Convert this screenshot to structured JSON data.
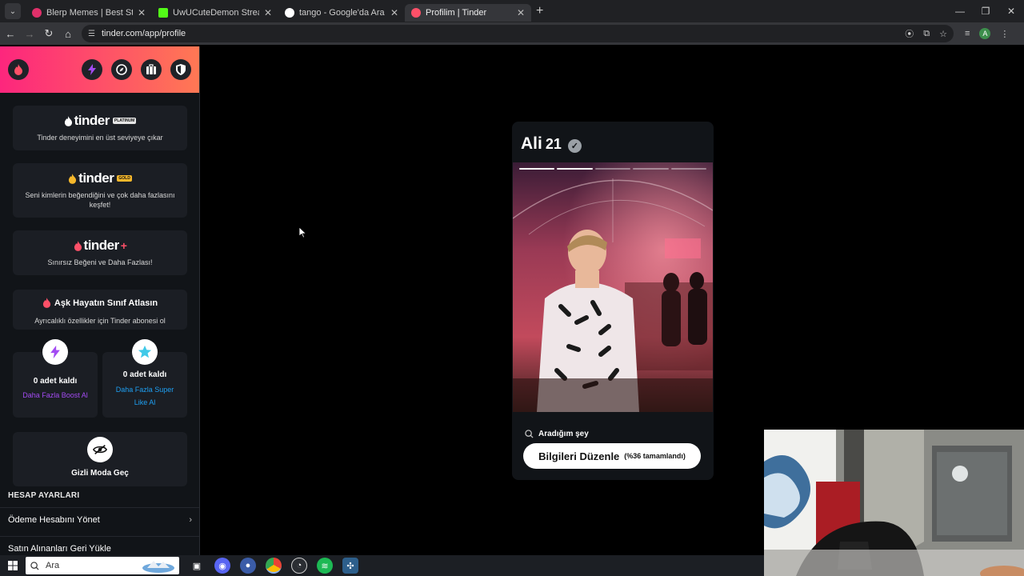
{
  "browser": {
    "tabs": [
      {
        "title": "Blerp Memes | Best Streamer So",
        "favicon_color": "#e0306a"
      },
      {
        "title": "UwUCuteDemon Stream - Watc",
        "favicon_color": "#53fc18"
      },
      {
        "title": "tango - Google'da Ara",
        "favicon_color": "#ffffff"
      },
      {
        "title": "Profilim | Tinder",
        "favicon_color": "#fd5068",
        "active": true
      }
    ],
    "url": "tinder.com/app/profile",
    "profile_initial": "A"
  },
  "sidebar": {
    "platinum": {
      "logo": "tinder",
      "badge": "PLATINUM",
      "desc": "Tinder deneyimini en üst seviyeye çıkar"
    },
    "gold": {
      "logo": "tinder",
      "badge": "GOLD",
      "desc": "Seni kimlerin beğendiğini ve çok daha fazlasını keşfet!"
    },
    "plus": {
      "logo": "tinder",
      "badge": "+",
      "desc": "Sınırsız Beğeni ve Daha Fazlası!"
    },
    "upgrade": {
      "title": "Aşk Hayatın Sınıf Atlasın",
      "desc": "Ayrıcalıklı özellikler için Tinder abonesi ol"
    },
    "boost": {
      "count": "0 adet kaldı",
      "link": "Daha Fazla Boost Al"
    },
    "superlike": {
      "count": "0 adet kaldı",
      "link": "Daha Fazla Super Like Al"
    },
    "incognito": {
      "label": "Gizli Moda Geç"
    },
    "account_section": "HESAP AYARLARI",
    "menu": [
      {
        "label": "Ödeme Hesabını Yönet"
      },
      {
        "label": "Satın Alınanları Geri Yükle"
      }
    ]
  },
  "profile": {
    "name": "Ali",
    "age": "21",
    "looking_for": "Aradığım şey",
    "edit_label": "Bilgileri Düzenle",
    "completion": "(%36 tamamlandı)",
    "photo_count": 5,
    "current_photo": 1
  },
  "taskbar": {
    "search_placeholder": "Ara"
  },
  "colors": {
    "tinder_gradient_start": "#fd267d",
    "tinder_gradient_end": "#ff7854",
    "boost_purple": "#a34bf2",
    "superlike_blue": "#1e9ff2",
    "gold": "#f5b72b"
  }
}
